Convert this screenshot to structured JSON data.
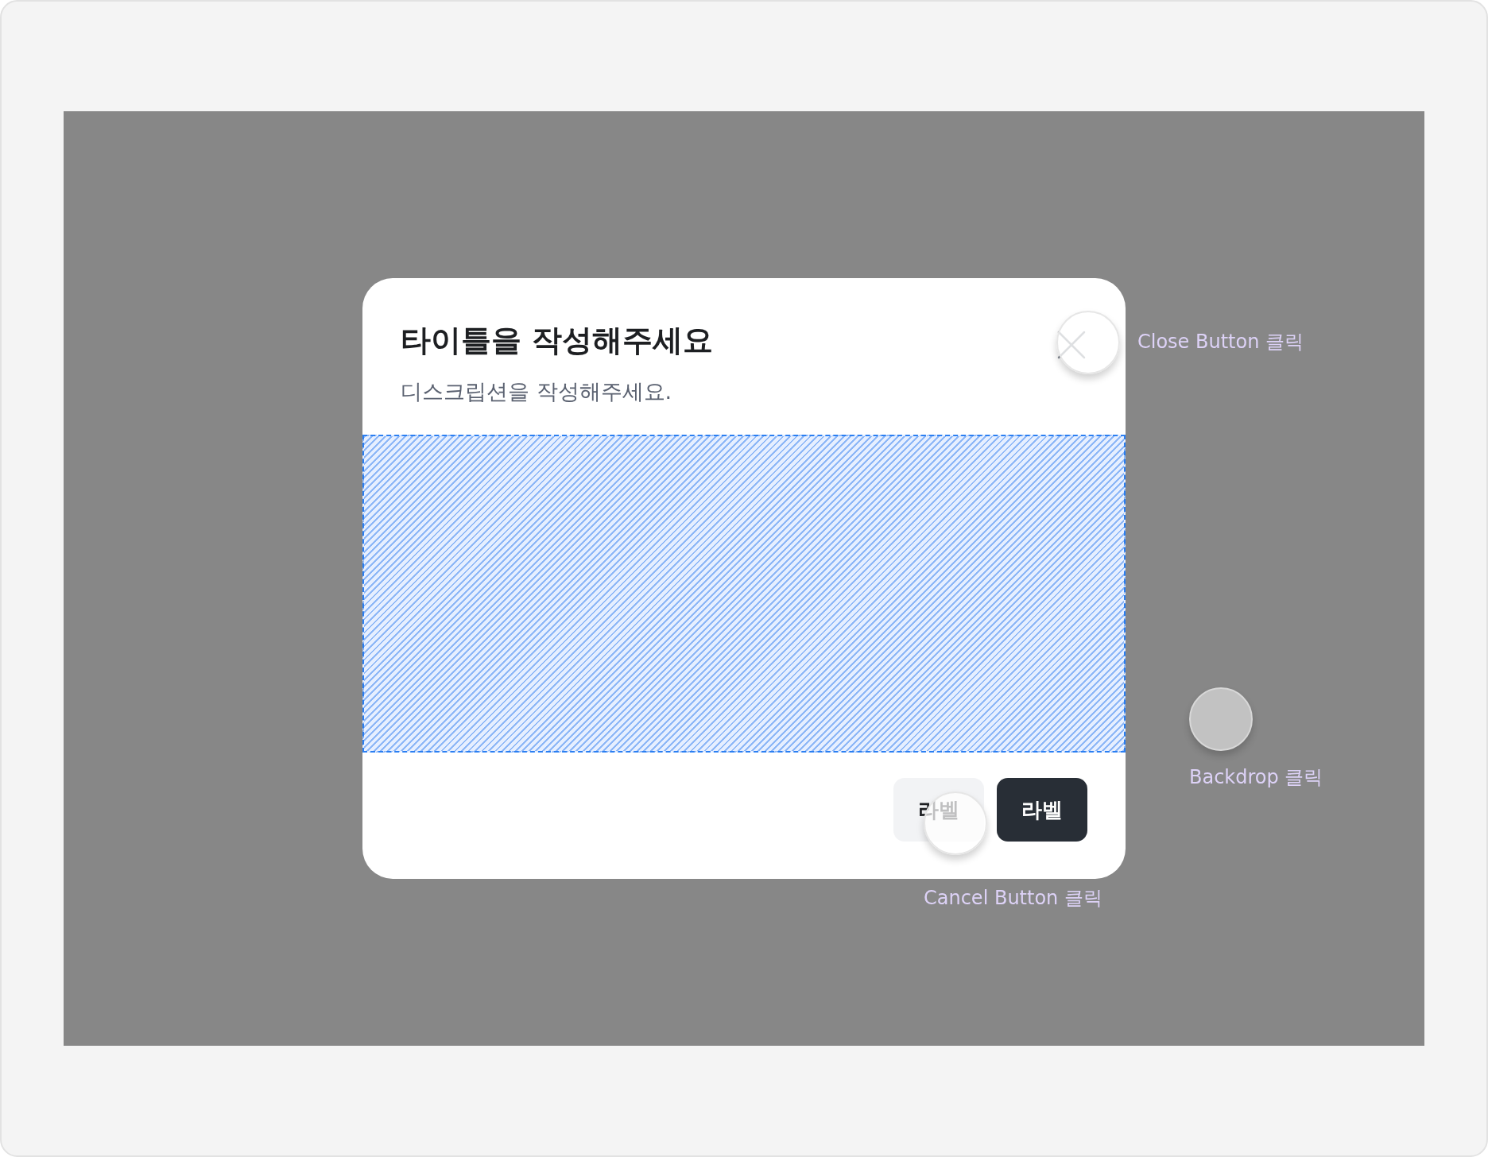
{
  "modal": {
    "title": "타이틀을 작성해주세요",
    "description": "디스크립션을 작성해주세요.",
    "content_slot": {
      "kind": "placeholder"
    },
    "buttons": [
      {
        "label": "라벨",
        "kind": "secondary"
      },
      {
        "label": "라벨",
        "kind": "primary"
      }
    ]
  },
  "touch_points": [
    {
      "kind": "close",
      "label": "Close Button 클릭"
    },
    {
      "kind": "backdrop",
      "label": "Backdrop 클릭"
    },
    {
      "kind": "cancel",
      "label": "Cancel Button 클릭"
    }
  ]
}
